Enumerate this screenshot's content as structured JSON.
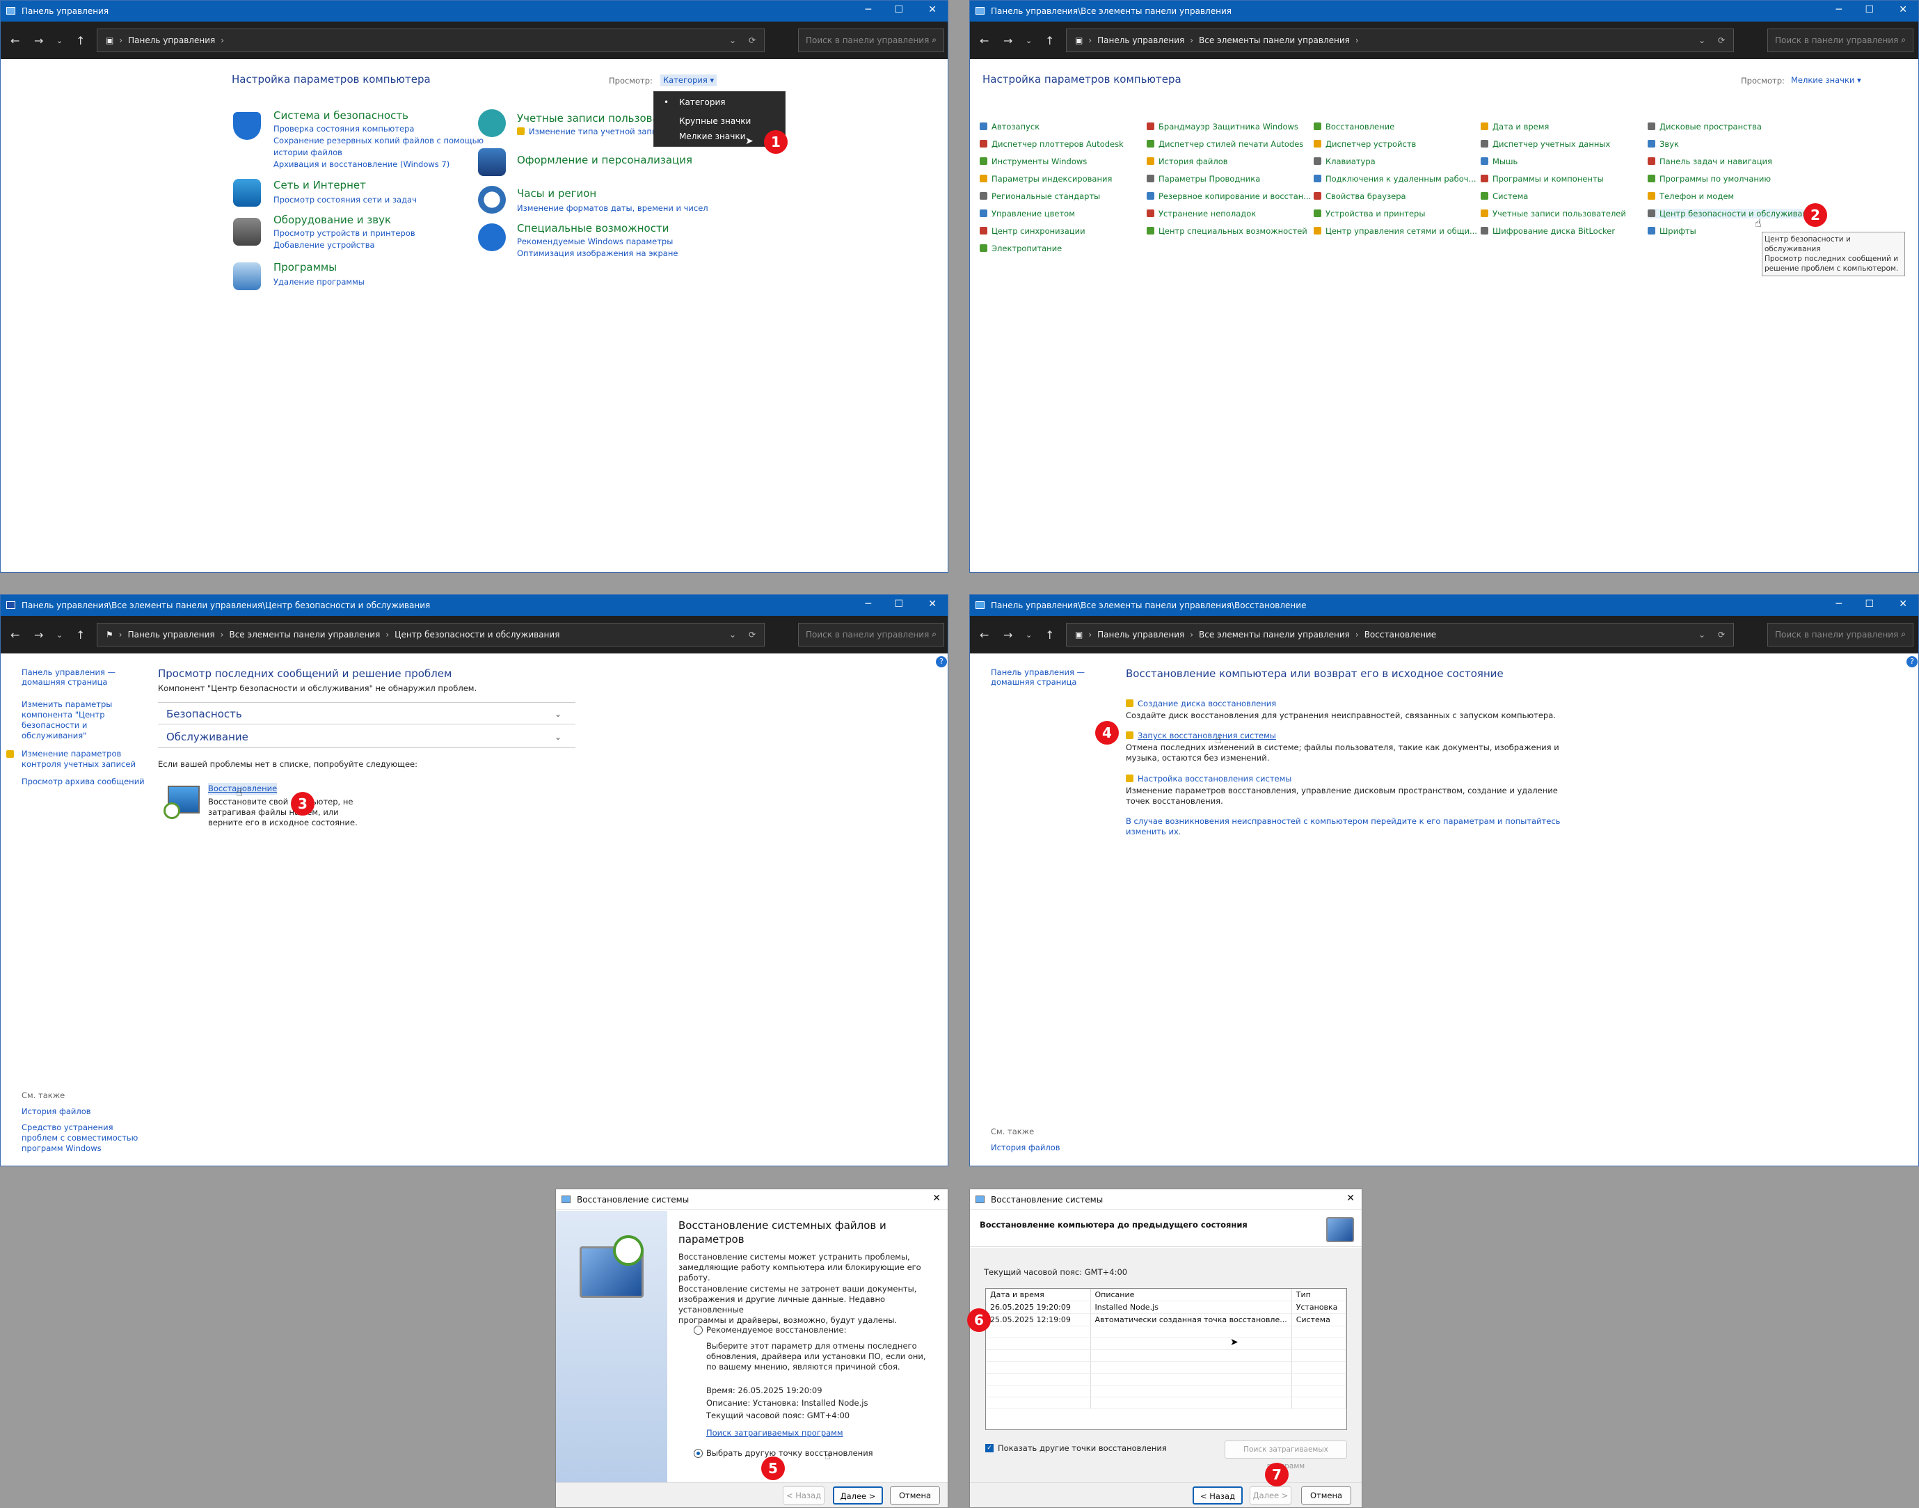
{
  "w1": {
    "title": "Панель управления",
    "crumbs": [
      "Панель управления"
    ],
    "search": "Поиск в панели управления",
    "heading": "Настройка параметров компьютера",
    "view_label": "Просмотр:",
    "view_value": "Категория ▾",
    "menu": [
      "Категория",
      "Крупные значки",
      "Мелкие значки"
    ],
    "cats": [
      {
        "title": "Система и безопасность",
        "links": [
          "Проверка состояния компьютера",
          "Сохранение резервных копий файлов с помощью",
          "истории файлов",
          "Архивация и восстановление (Windows 7)"
        ]
      },
      {
        "title": "Сеть и Интернет",
        "links": [
          "Просмотр состояния сети и задач"
        ]
      },
      {
        "title": "Оборудование и звук",
        "links": [
          "Просмотр устройств и принтеров",
          "Добавление устройства"
        ]
      },
      {
        "title": "Программы",
        "links": [
          "Удаление программы"
        ]
      },
      {
        "title": "Учетные записи пользовате",
        "links": [
          "Изменение типа учетной записи"
        ]
      },
      {
        "title": "Оформление и персонализация",
        "links": []
      },
      {
        "title": "Часы и регион",
        "links": [
          "Изменение форматов даты, времени и чисел"
        ]
      },
      {
        "title": "Специальные возможности",
        "links": [
          "Рекомендуемые Windows параметры",
          "Оптимизация изображения на экране"
        ]
      }
    ]
  },
  "w2": {
    "title": "Панель управления\\Все элементы панели управления",
    "crumbs": [
      "Панель управления",
      "Все элементы панели управления"
    ],
    "search": "Поиск в панели управления",
    "heading": "Настройка параметров компьютера",
    "view_label": "Просмотр:",
    "view_value": "Мелкие значки ▾",
    "cols": [
      [
        "Автозапуск",
        "Диспетчер плоттеров Autodesk",
        "Инструменты Windows",
        "Параметры индексирования",
        "Региональные стандарты",
        "Управление цветом",
        "Центр синхронизации",
        "Электропитание"
      ],
      [
        "Брандмауэр Защитника Windows",
        "Диспетчер стилей печати Autodes",
        "История файлов",
        "Параметры Проводника",
        "Резервное копирование и восстан...",
        "Устранение неполадок",
        "Центр специальных возможностей"
      ],
      [
        "Восстановление",
        "Диспетчер устройств",
        "Клавиатура",
        "Подключения к удаленным рабоч...",
        "Свойства браузера",
        "Устройства и принтеры",
        "Центр управления сетями и общи..."
      ],
      [
        "Дата и время",
        "Диспетчер учетных данных",
        "Мышь",
        "Программы и компоненты",
        "Система",
        "Учетные записи пользователей",
        "Шифрование диска BitLocker"
      ],
      [
        "Дисковые пространства",
        "Звук",
        "Панель задач и навигация",
        "Программы по умолчанию",
        "Телефон и модем",
        "Центр безопасности и обслуживан",
        "Шрифты"
      ]
    ],
    "tooltip": [
      "Центр безопасности и",
      "обслуживания",
      "Просмотр последних сообщений и",
      "решение проблем с компьютером."
    ]
  },
  "w3": {
    "title": "Панель управления\\Все элементы панели управления\\Центр безопасности и обслуживания",
    "crumbs": [
      "Панель управления",
      "Все элементы панели управления",
      "Центр безопасности и обслуживания"
    ],
    "search": "Поиск в панели управления",
    "side": [
      "Панель управления —",
      "домашняя страница",
      "Изменить параметры",
      "компонента \"Центр",
      "безопасности и",
      "обслуживания\"",
      "Изменение параметров",
      "контроля учетных записей",
      "Просмотр архива сообщений"
    ],
    "heading": "Просмотр последних сообщений и решение проблем",
    "sub": "Компонент \"Центр безопасности и обслуживания\" не обнаружил проблем.",
    "sec1": "Безопасность",
    "sec2": "Обслуживание",
    "try": "Если вашей проблемы нет в списке, попробуйте следующее:",
    "rec_title": "Восстановление",
    "rec_desc": [
      "Восстановите свой компьютер, не",
      "затрагивая файлы на нем, или",
      "верните его в исходное состояние."
    ],
    "see": "См. также",
    "see_links": [
      "История файлов",
      "Средство устранения",
      "проблем с совместимостью",
      "программ Windows"
    ]
  },
  "w4": {
    "title": "Панель управления\\Все элементы панели управления\\Восстановление",
    "crumbs": [
      "Панель управления",
      "Все элементы панели управления",
      "Восстановление"
    ],
    "search": "Поиск в панели управления",
    "side": [
      "Панель управления —",
      "домашняя страница"
    ],
    "heading": "Восстановление компьютера или возврат его в исходное состояние",
    "items": [
      {
        "title": "Создание диска восстановления",
        "desc": [
          "Создайте диск восстановления для устранения неисправностей, связанных с запуском компьютера."
        ]
      },
      {
        "title": "Запуск восстановления системы",
        "desc": [
          "Отмена последних изменений в системе; файлы пользователя, такие как документы, изображения и",
          "музыка, остаются без изменений."
        ]
      },
      {
        "title": "Настройка восстановления системы",
        "desc": [
          "Изменение параметров восстановления, управление дисковым пространством, создание и удаление",
          "точек восстановления."
        ]
      }
    ],
    "note": [
      "В случае возникновения неисправностей с компьютером перейдите к его параметрам и попытайтесь",
      "изменить их."
    ],
    "see": "См. также",
    "see_link": "История файлов"
  },
  "w5": {
    "title": "Восстановление системы",
    "h": [
      "Восстановление системных файлов и",
      "параметров"
    ],
    "p1": [
      "Восстановление системы может устранить проблемы,",
      "замедляющие работу компьютера или блокирующие его работу."
    ],
    "p2": [
      "Восстановление системы не затронет ваши документы,",
      "изображения и другие личные данные. Недавно установленные",
      "программы и драйверы, возможно, будут удалены."
    ],
    "opt1": "Рекомендуемое восстановление:",
    "opt1_desc": [
      "Выберите этот параметр для отмены последнего",
      "обновления, драйвера или установки ПО, если они,",
      "по вашему мнению, являются причиной сбоя."
    ],
    "time": "Время: 26.05.2025 19:20:09",
    "descr": "Описание: Установка: Installed Node.js",
    "tz": "Текущий часовой пояс: GMT+4:00",
    "scan": "Поиск затрагиваемых программ",
    "opt2": "Выбрать другую точку восстановления",
    "back": "< Назад",
    "next": "Далее >",
    "cancel": "Отмена"
  },
  "w6": {
    "title": "Восстановление системы",
    "h": "Восстановление компьютера до предыдущего состояния",
    "tz": "Текущий часовой пояс: GMT+4:00",
    "cols": [
      "Дата и время",
      "Описание",
      "Тип"
    ],
    "rows": [
      [
        "26.05.2025 19:20:09",
        "Installed Node.js",
        "Установка"
      ],
      [
        "25.05.2025 12:19:09",
        "Автоматически созданная точка восстановле...",
        "Система"
      ]
    ],
    "show": "Показать другие точки восстановления",
    "scan": "Поиск затрагиваемых программ",
    "back": "< Назад",
    "next": "Далее >",
    "cancel": "Отмена"
  },
  "badges": [
    "1",
    "2",
    "3",
    "4",
    "5",
    "6",
    "7"
  ]
}
